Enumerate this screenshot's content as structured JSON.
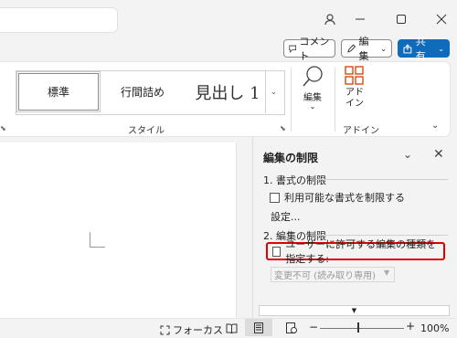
{
  "window": {
    "icons": {
      "user": "person-icon",
      "minimize": "minimize-icon",
      "maximize": "maximize-icon",
      "close": "close-icon"
    }
  },
  "actions": {
    "comment_label": "コメント",
    "edit_label": "編集",
    "share_label": "共有",
    "share_color": "#0f6cbd"
  },
  "ribbon": {
    "styles": [
      "標準",
      "行間詰め",
      "見出し 1"
    ],
    "style_group_label": "スタイル",
    "edit_button_label": "編集",
    "addin_button_label": "アド\nイン",
    "addin_group_label": "アドイン"
  },
  "pane": {
    "title": "編集の制限",
    "section1_title": "1. 書式の制限",
    "formatting_checkbox_label": "利用可能な書式を制限する",
    "settings_link": "設定...",
    "section2_title": "2. 編集の制限",
    "editing_checkbox_label": "ユーザーに許可する編集の種類を指定する:",
    "edit_type_value": "変更不可 (読み取り専用)",
    "highlight_color": "#e00000"
  },
  "status": {
    "focus_label": "フォーカス",
    "zoom_level": "100%",
    "zoom_out": "−",
    "zoom_in": "+"
  }
}
